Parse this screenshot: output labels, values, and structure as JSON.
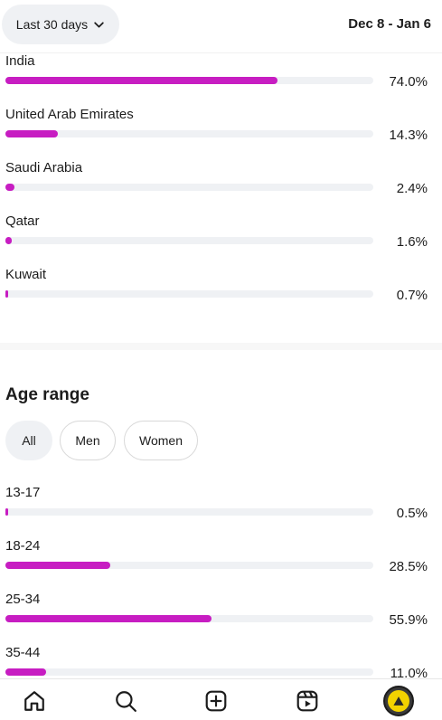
{
  "header": {
    "range_label": "Last 30 days",
    "date_range": "Dec 8 - Jan 6"
  },
  "countries": [
    {
      "label": "India",
      "pct": "74.0%",
      "value": 74.0
    },
    {
      "label": "United Arab Emirates",
      "pct": "14.3%",
      "value": 14.3
    },
    {
      "label": "Saudi Arabia",
      "pct": "2.4%",
      "value": 2.4
    },
    {
      "label": "Qatar",
      "pct": "1.6%",
      "value": 1.6
    },
    {
      "label": "Kuwait",
      "pct": "0.7%",
      "value": 0.7
    }
  ],
  "age_section": {
    "title": "Age range",
    "filters": [
      "All",
      "Men",
      "Women"
    ],
    "selected_filter": "All",
    "rows": [
      {
        "label": "13-17",
        "pct": "0.5%",
        "value": 0.5
      },
      {
        "label": "18-24",
        "pct": "28.5%",
        "value": 28.5
      },
      {
        "label": "25-34",
        "pct": "55.9%",
        "value": 55.9
      },
      {
        "label": "35-44",
        "pct": "11.0%",
        "value": 11.0
      }
    ]
  },
  "colors": {
    "bar": "#c71dc2",
    "track": "#eff1f4"
  },
  "nav": {
    "items": [
      "home-icon",
      "search-icon",
      "create-icon",
      "reels-icon",
      "profile-avatar"
    ]
  }
}
